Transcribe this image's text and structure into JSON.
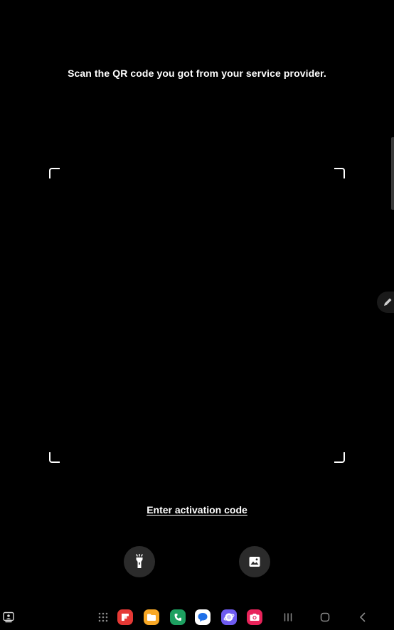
{
  "scanner": {
    "instruction": "Scan the QR code you got from your service provider.",
    "activation_link": "Enter activation code"
  },
  "actions": {
    "flashlight_icon": "flashlight-icon",
    "gallery_icon": "image-icon"
  },
  "taskbar": {
    "apps": [
      {
        "name": "app-drawer",
        "icon": "grid-icon"
      },
      {
        "name": "flipboard",
        "icon": "flipboard-icon",
        "color": "#E53935"
      },
      {
        "name": "my-files",
        "icon": "folder-icon",
        "color": "#F9A825"
      },
      {
        "name": "phone",
        "icon": "phone-icon",
        "color": "#1DA060"
      },
      {
        "name": "messages",
        "icon": "chat-bubble-icon",
        "color": "#1E6FE8"
      },
      {
        "name": "samsung-internet",
        "icon": "globe-icon",
        "color": "#6E5BF0"
      },
      {
        "name": "camera",
        "icon": "camera-icon",
        "color": "#E8235A"
      }
    ],
    "nav": [
      "recents-icon",
      "home-icon",
      "back-icon"
    ]
  },
  "colors": {
    "background": "#000000",
    "text": "#FFFFFF",
    "button_bg": "#2B2B2B"
  }
}
